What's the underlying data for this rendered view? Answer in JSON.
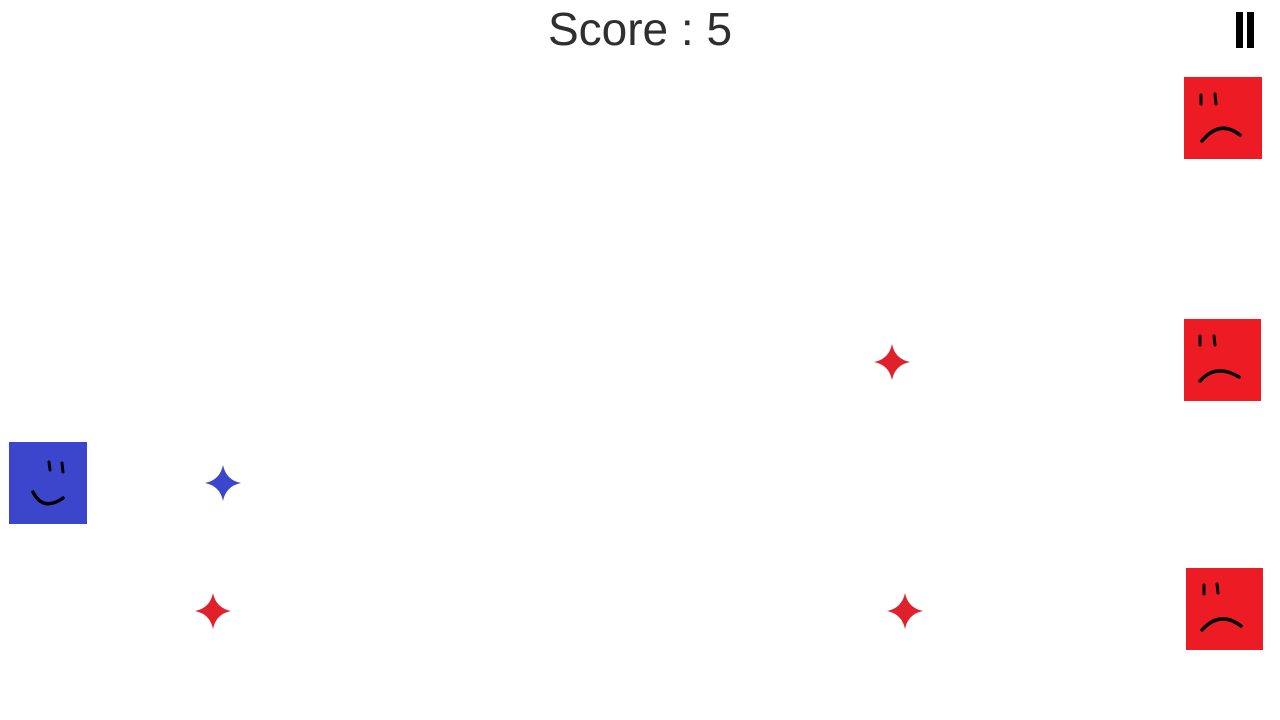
{
  "hud": {
    "score_text": "Score : 5"
  },
  "colors": {
    "background": "#ffffff",
    "player": "#3b46cc",
    "enemy": "#ed1c24",
    "player_bullet": "#3b46cc",
    "enemy_bullet": "#e0202a",
    "face_ink": "#000000"
  },
  "icons": {
    "pause": "pause-icon",
    "player": "smiling-square-icon",
    "enemy": "frowning-square-icon",
    "bullet": "four-point-star-icon"
  },
  "entities": {
    "player": {
      "type": "player",
      "mood": "happy"
    },
    "enemies": [
      {
        "type": "enemy",
        "mood": "sad"
      },
      {
        "type": "enemy",
        "mood": "sad"
      },
      {
        "type": "enemy",
        "mood": "sad"
      }
    ],
    "player_bullets": [
      {
        "type": "player-bullet"
      }
    ],
    "enemy_bullets": [
      {
        "type": "enemy-bullet"
      },
      {
        "type": "enemy-bullet"
      },
      {
        "type": "enemy-bullet"
      }
    ]
  }
}
